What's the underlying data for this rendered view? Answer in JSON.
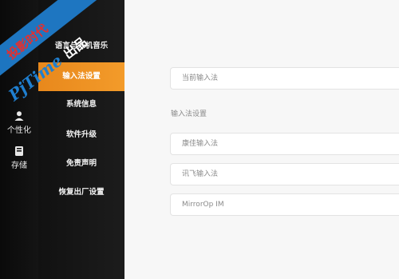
{
  "rail": {
    "items": [
      {
        "label": "个性化",
        "icon": "person-icon"
      },
      {
        "label": "存储",
        "icon": "storage-icon"
      }
    ]
  },
  "menu": {
    "items": [
      {
        "label": "语言与开机音乐",
        "active": false
      },
      {
        "label": "输入法设置",
        "active": true
      },
      {
        "label": "系统信息",
        "active": false
      },
      {
        "label": "软件升级",
        "active": false
      },
      {
        "label": "免责声明",
        "active": false
      },
      {
        "label": "恢复出厂设置",
        "active": false
      }
    ]
  },
  "panel": {
    "current_input": "当前输入法",
    "section_label": "输入法设置",
    "methods": [
      "康佳输入法",
      "讯飞输入法",
      "MirrorOp IM"
    ]
  },
  "watermark": {
    "top_text": "投影时代",
    "brand": "PjTime",
    "brand_suffix": "出品"
  },
  "colors": {
    "accent": "#f0922a",
    "menu_bg": "#161616",
    "panel_bg": "#f7f7f7",
    "watermark_blue": "#1f7fd0",
    "watermark_red": "#e23030"
  }
}
